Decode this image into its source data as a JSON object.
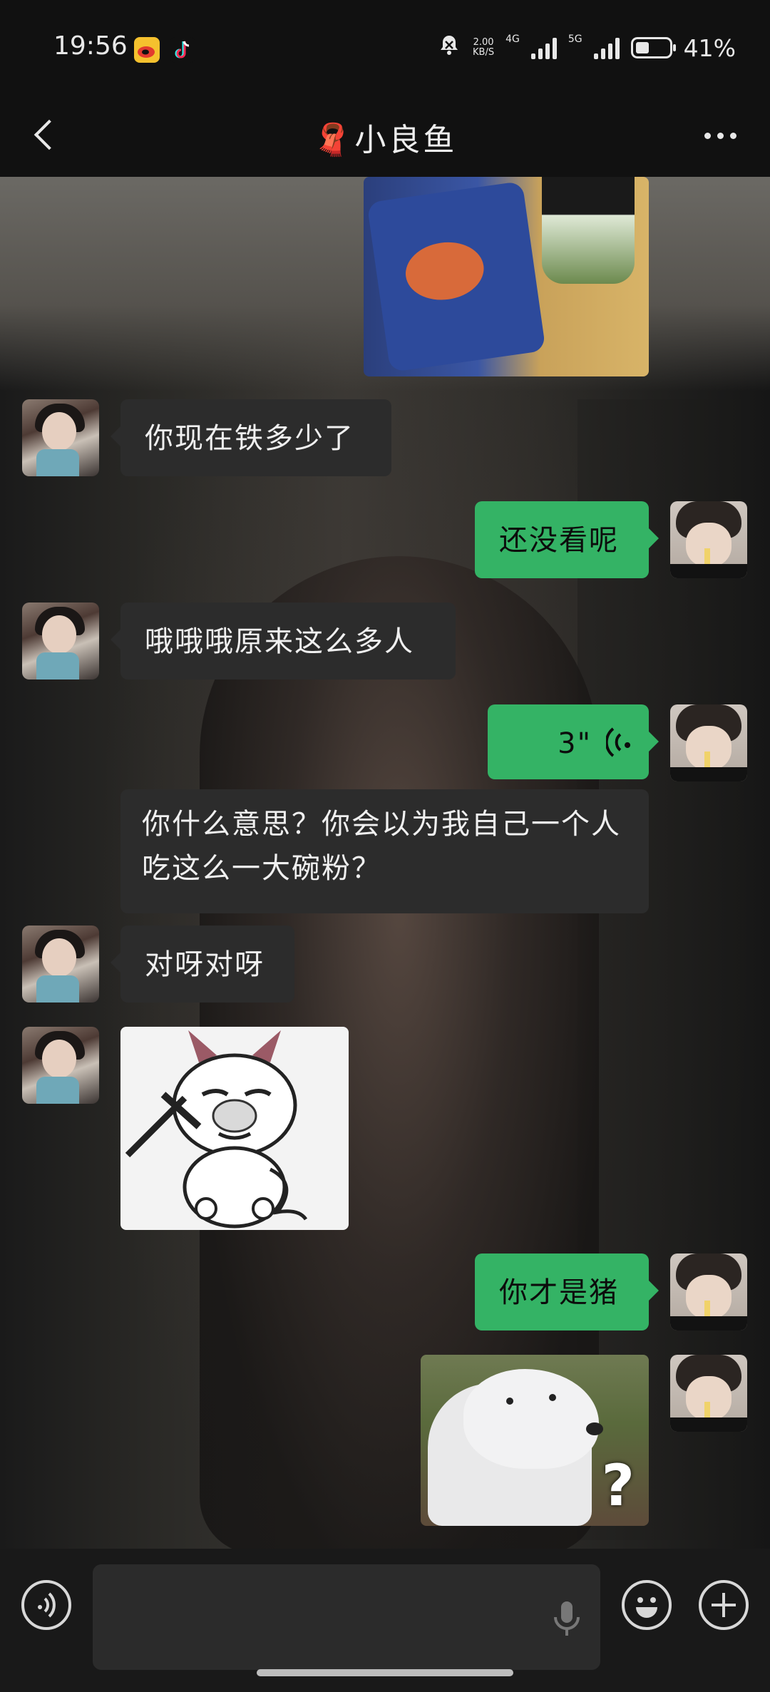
{
  "status_bar": {
    "time": "19:56",
    "net_speed_top": "2.00",
    "net_speed_bottom": "KB/S",
    "sim1": "4G",
    "sim2": "5G",
    "battery": "41%",
    "battery_level": 0.41
  },
  "header": {
    "title_emoji": "🧣",
    "title": "小良鱼"
  },
  "messages": [
    {
      "type": "image",
      "side": "right",
      "content": "food-photo"
    },
    {
      "type": "text",
      "side": "left",
      "text": "你现在铁多少了"
    },
    {
      "type": "text",
      "side": "right",
      "text": "还没看呢"
    },
    {
      "type": "text",
      "side": "left",
      "text": "哦哦哦原来这么多人"
    },
    {
      "type": "voice",
      "side": "right",
      "duration": "3\""
    },
    {
      "type": "text",
      "side": "left",
      "text": "你什么意思？你会以为我自己一个人吃这么一大碗粉？"
    },
    {
      "type": "text",
      "side": "left",
      "text": "对呀对呀"
    },
    {
      "type": "image",
      "side": "left",
      "content": "devil-sticker"
    },
    {
      "type": "text",
      "side": "right",
      "text": "你才是猪"
    },
    {
      "type": "image",
      "side": "right",
      "content": "dog-question-sticker"
    }
  ],
  "icons": {
    "back": "chevron-left-icon",
    "more": "more-horizontal-icon",
    "voice_toggle": "voice-icon",
    "mic": "mic-icon",
    "emoji": "emoji-icon",
    "plus": "plus-icon"
  },
  "colors": {
    "outgoing_bubble": "#34b365",
    "incoming_bubble": "#2c2c2c"
  }
}
